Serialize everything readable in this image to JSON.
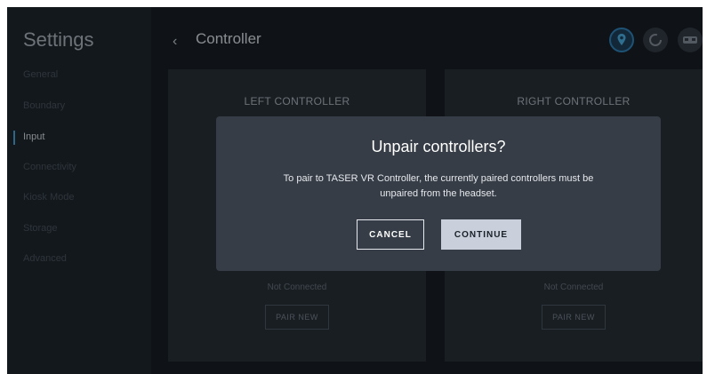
{
  "sidebar": {
    "title": "Settings",
    "items": [
      {
        "label": "General"
      },
      {
        "label": "Boundary"
      },
      {
        "label": "Input"
      },
      {
        "label": "Connectivity"
      },
      {
        "label": "Kiosk Mode"
      },
      {
        "label": "Storage"
      },
      {
        "label": "Advanced"
      }
    ],
    "active_item": "Input"
  },
  "header": {
    "back_icon": "chevron-left-icon",
    "title": "Controller",
    "icons": [
      "location-pin-icon",
      "refresh-icon",
      "vr-headset-icon"
    ]
  },
  "cards": {
    "left": {
      "title": "LEFT CONTROLLER",
      "status": "Not Connected",
      "button": "PAIR NEW"
    },
    "right": {
      "title": "RIGHT CONTROLLER",
      "status": "Not Connected",
      "button": "PAIR NEW"
    }
  },
  "dialog": {
    "title": "Unpair controllers?",
    "message": "To pair to TASER VR Controller, the currently paired controllers must be unpaired from the headset.",
    "cancel_label": "CANCEL",
    "continue_label": "CONTINUE"
  },
  "colors": {
    "accent": "#4aa8e0",
    "background": "#15191f",
    "dialog": "#363d46",
    "primary_button": "#c9d0db"
  }
}
